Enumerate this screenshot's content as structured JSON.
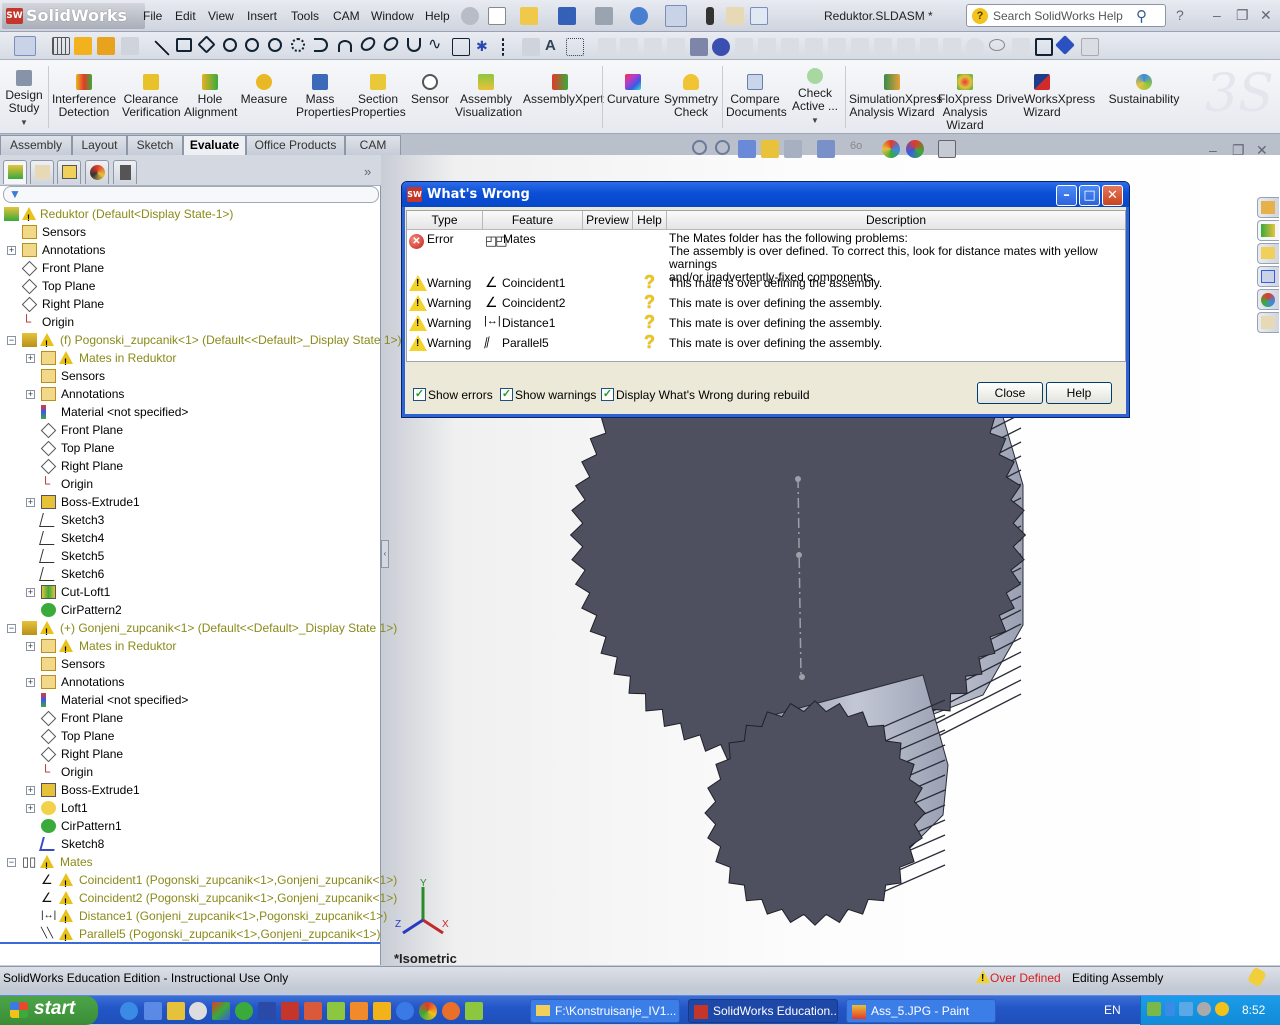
{
  "app": {
    "brand": "SolidWorks",
    "document_title": "Reduktor.SLDASM *",
    "menu": [
      "File",
      "Edit",
      "View",
      "Insert",
      "Tools",
      "CAM",
      "Window",
      "Help"
    ],
    "search_placeholder": "Search SolidWorks Help"
  },
  "command_manager": {
    "items": [
      {
        "label": "Design Study",
        "icon": "design-study-icon"
      },
      {
        "label": "Interference Detection",
        "icon": "interference-icon"
      },
      {
        "label": "Clearance Verification",
        "icon": "clearance-icon"
      },
      {
        "label": "Hole Alignment",
        "icon": "hole-alignment-icon"
      },
      {
        "label": "Measure",
        "icon": "measure-icon"
      },
      {
        "label": "Mass Properties",
        "icon": "mass-properties-icon"
      },
      {
        "label": "Section Properties",
        "icon": "section-properties-icon"
      },
      {
        "label": "Sensor",
        "icon": "sensor-icon"
      },
      {
        "label": "Assembly Visualization",
        "icon": "assembly-visualization-icon"
      },
      {
        "label": "AssemblyXpert",
        "icon": "assemblyxpert-icon"
      },
      {
        "label": "Curvature",
        "icon": "curvature-icon"
      },
      {
        "label": "Symmetry Check",
        "icon": "symmetry-icon"
      },
      {
        "label": "Compare Documents",
        "icon": "compare-icon"
      },
      {
        "label": "Check Active ...",
        "icon": "check-active-icon"
      },
      {
        "label": "SimulationXpress Analysis Wizard",
        "icon": "simulationxpress-icon"
      },
      {
        "label": "FloXpress Analysis Wizard",
        "icon": "floxpress-icon"
      },
      {
        "label": "DriveWorksXpress Wizard",
        "icon": "driveworks-icon"
      },
      {
        "label": "Sustainability",
        "icon": "sustainability-icon"
      }
    ],
    "tabs": [
      "Assembly",
      "Layout",
      "Sketch",
      "Evaluate",
      "Office Products",
      "CAM"
    ],
    "active_tab": "Evaluate"
  },
  "tree": {
    "root": "Reduktor  (Default<Display State-1>)",
    "items": [
      {
        "label": "Sensors",
        "level": 1
      },
      {
        "label": "Annotations",
        "level": 1
      },
      {
        "label": "Front Plane",
        "level": 1
      },
      {
        "label": "Top Plane",
        "level": 1
      },
      {
        "label": "Right Plane",
        "level": 1
      },
      {
        "label": "Origin",
        "level": 1
      },
      {
        "label": "(f) Pogonski_zupcanik<1> (Default<<Default>_Display State 1>)",
        "level": 1,
        "warning": true
      },
      {
        "label": "Mates in Reduktor",
        "level": 2,
        "warning": true
      },
      {
        "label": "Sensors",
        "level": 2
      },
      {
        "label": "Annotations",
        "level": 2
      },
      {
        "label": "Material <not specified>",
        "level": 2
      },
      {
        "label": "Front Plane",
        "level": 2
      },
      {
        "label": "Top Plane",
        "level": 2
      },
      {
        "label": "Right Plane",
        "level": 2
      },
      {
        "label": "Origin",
        "level": 2
      },
      {
        "label": "Boss-Extrude1",
        "level": 2
      },
      {
        "label": "Sketch3",
        "level": 2
      },
      {
        "label": "Sketch4",
        "level": 2
      },
      {
        "label": "Sketch5",
        "level": 2
      },
      {
        "label": "Sketch6",
        "level": 2
      },
      {
        "label": "Cut-Loft1",
        "level": 2
      },
      {
        "label": "CirPattern2",
        "level": 2
      },
      {
        "label": "(+) Gonjeni_zupcanik<1> (Default<<Default>_Display State 1>)",
        "level": 1,
        "warning": true
      },
      {
        "label": "Mates in Reduktor",
        "level": 2,
        "warning": true
      },
      {
        "label": "Sensors",
        "level": 2
      },
      {
        "label": "Annotations",
        "level": 2
      },
      {
        "label": "Material <not specified>",
        "level": 2
      },
      {
        "label": "Front Plane",
        "level": 2
      },
      {
        "label": "Top Plane",
        "level": 2
      },
      {
        "label": "Right Plane",
        "level": 2
      },
      {
        "label": "Origin",
        "level": 2
      },
      {
        "label": "Boss-Extrude1",
        "level": 2
      },
      {
        "label": "Loft1",
        "level": 2
      },
      {
        "label": "CirPattern1",
        "level": 2
      },
      {
        "label": "Sketch8",
        "level": 2
      },
      {
        "label": "Mates",
        "level": 1,
        "warning": true
      },
      {
        "label": "Coincident1 (Pogonski_zupcanik<1>,Gonjeni_zupcanik<1>)",
        "level": 2,
        "warning": true
      },
      {
        "label": "Coincident2 (Pogonski_zupcanik<1>,Gonjeni_zupcanik<1>)",
        "level": 2,
        "warning": true
      },
      {
        "label": "Distance1 (Gonjeni_zupcanik<1>,Pogonski_zupcanik<1>)",
        "level": 2,
        "warning": true
      },
      {
        "label": "Parallel5 (Pogonski_zupcanik<1>,Gonjeni_zupcanik<1>)",
        "level": 2,
        "warning": true
      }
    ]
  },
  "dialog": {
    "title": "What's Wrong",
    "columns": [
      "Type",
      "Feature",
      "Preview",
      "Help",
      "Description"
    ],
    "rows": [
      {
        "type": "Error",
        "feature": "Mates",
        "help": false,
        "description": [
          "The Mates folder has the following problems:",
          "The assembly is over defined.  To correct this, look for distance mates with yellow warnings",
          "and/or inadvertently-fixed components."
        ]
      },
      {
        "type": "Warning",
        "feature": "Coincident1",
        "help": true,
        "description": [
          "This mate is over defining the assembly."
        ]
      },
      {
        "type": "Warning",
        "feature": "Coincident2",
        "help": true,
        "description": [
          "This mate is over defining the assembly."
        ]
      },
      {
        "type": "Warning",
        "feature": "Distance1",
        "help": true,
        "description": [
          "This mate is over defining the assembly."
        ]
      },
      {
        "type": "Warning",
        "feature": "Parallel5",
        "help": true,
        "description": [
          "This mate is over defining the assembly."
        ]
      }
    ],
    "checkboxes": [
      {
        "label": "Show errors",
        "checked": true
      },
      {
        "label": "Show warnings",
        "checked": true
      },
      {
        "label": "Display What's Wrong during rebuild",
        "checked": true
      }
    ],
    "close_label": "Close",
    "help_label": "Help"
  },
  "viewport": {
    "view_label": "*Isometric",
    "triad": {
      "x": "X",
      "y": "Y",
      "z": "Z"
    }
  },
  "status": {
    "left": "SolidWorks Education Edition - Instructional Use Only",
    "state": "Over Defined",
    "mode": "Editing Assembly"
  },
  "taskbar": {
    "start": "start",
    "windows": [
      {
        "label": "F:\\Konstruisanje_IV1...",
        "active": false
      },
      {
        "label": "SolidWorks Education...",
        "active": true
      },
      {
        "label": "Ass_5.JPG - Paint",
        "active": false
      }
    ],
    "language": "EN",
    "clock": "8:52"
  }
}
